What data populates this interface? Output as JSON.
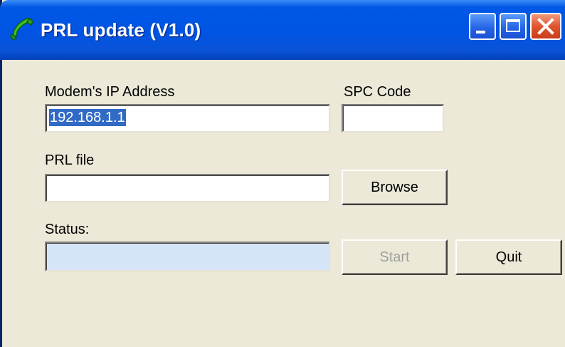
{
  "window": {
    "title": "PRL update (V1.0)",
    "icon": "phone-icon"
  },
  "form": {
    "ip_label": "Modem's IP Address",
    "ip_value": "192.168.1.1",
    "spc_label": "SPC Code",
    "spc_value": "",
    "prl_label": "PRL file",
    "prl_value": "",
    "status_label": "Status:",
    "status_value": ""
  },
  "buttons": {
    "browse": "Browse",
    "start": "Start",
    "quit": "Quit"
  },
  "colors": {
    "titlebar": "#0054e3",
    "dialog_bg": "#ece9d8",
    "selection": "#316ac5",
    "status_bg": "#d6e4f7"
  }
}
